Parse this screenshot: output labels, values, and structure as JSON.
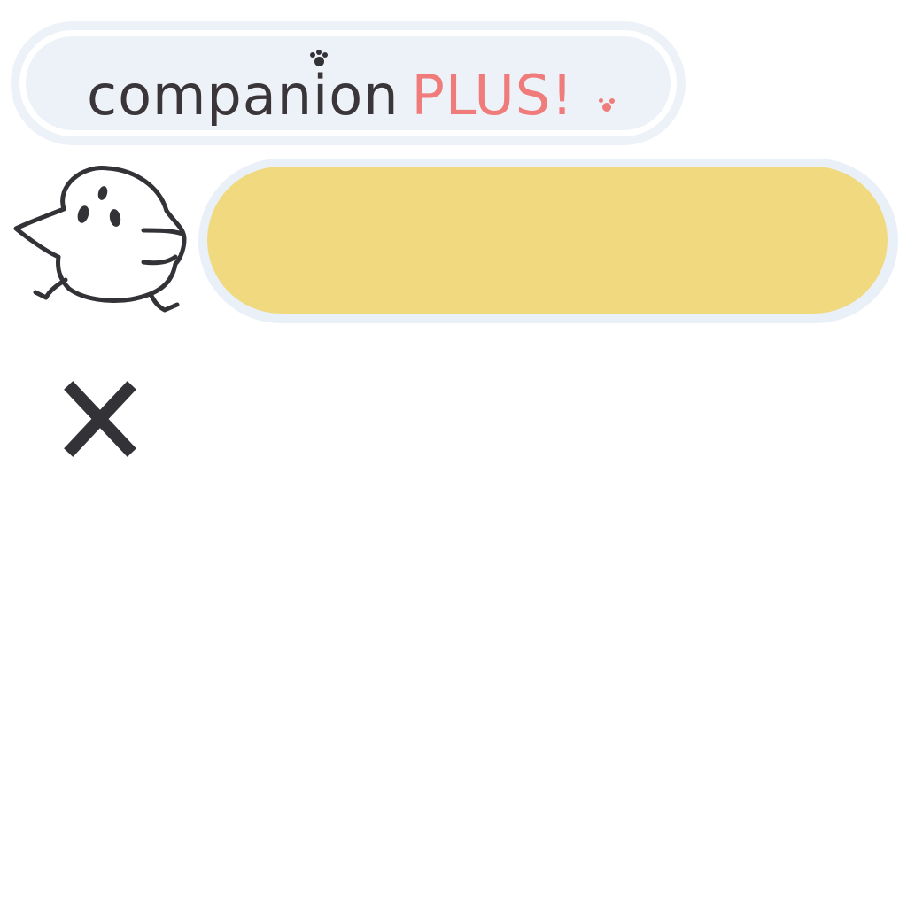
{
  "logo": {
    "word": "companion",
    "plus": "PLUS!"
  },
  "dialog": {
    "message": ""
  },
  "icons": {
    "mascot": "bird-mascot-icon",
    "close": "close-icon",
    "paw": "paw-print-icon"
  },
  "colors": {
    "logo_text": "#3a3538",
    "logo_accent": "#f07b7b",
    "pill_background": "#edf2f8",
    "dialog_fill": "#f1d980",
    "icon_dark": "#333236"
  }
}
